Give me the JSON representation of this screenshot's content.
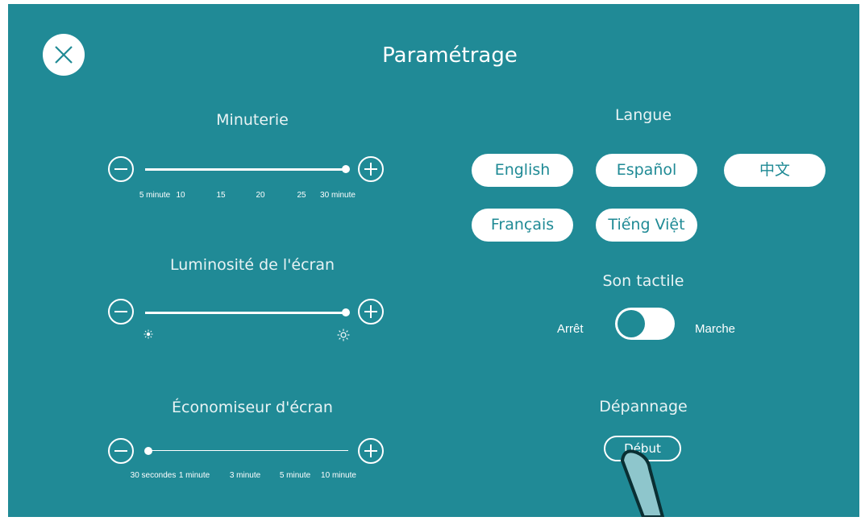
{
  "header": {
    "title": "Paramétrage"
  },
  "timer": {
    "title": "Minuterie",
    "ticks": [
      "5 minute",
      "10",
      "15",
      "20",
      "25",
      "30 minute"
    ],
    "value_fraction": 1.0
  },
  "brightness": {
    "title": "Luminosité de l'écran",
    "min_icon": "dim-sun-icon",
    "max_icon": "bright-sun-icon",
    "value_fraction": 1.0
  },
  "screensaver": {
    "title": "Économiseur d'écran",
    "ticks": [
      "30 secondes",
      "1 minute",
      "3 minute",
      "5 minute",
      "10 minute"
    ],
    "value_fraction": 0.0
  },
  "language": {
    "title": "Langue",
    "options": [
      "English",
      "Español",
      "中文",
      "Français",
      "Tiếng Việt"
    ]
  },
  "touch_sound": {
    "title": "Son tactile",
    "off_label": "Arrêt",
    "on_label": "Marche",
    "state": "off"
  },
  "troubleshooting": {
    "title": "Dépannage",
    "start_label": "Début"
  },
  "colors": {
    "background": "#208a96",
    "accent": "#1f8a95",
    "foreground": "#ffffff"
  }
}
